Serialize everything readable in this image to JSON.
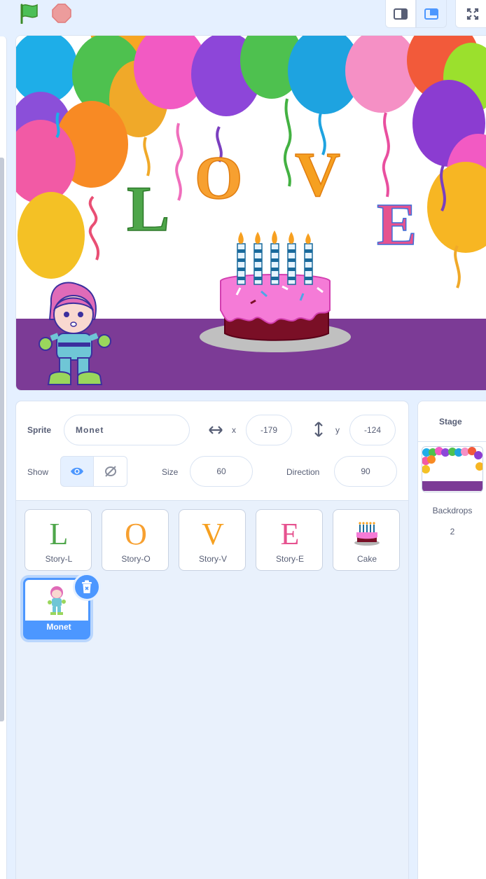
{
  "controls": {
    "green_flag_icon": "green-flag-icon",
    "stop_icon": "stop-sign-icon",
    "layout_modes": [
      "small-stage-icon",
      "normal-stage-icon",
      "fullscreen-icon"
    ]
  },
  "stage_art": {
    "letters": [
      "L",
      "O",
      "V",
      "E"
    ],
    "colors": {
      "ground": "#7c3b96",
      "accent": "#4c97ff"
    }
  },
  "sprite_info": {
    "sprite_label": "Sprite",
    "sprite_name": "Monet",
    "x_label": "x",
    "x_value": "-179",
    "y_label": "y",
    "y_value": "-124",
    "show_label": "Show",
    "size_label": "Size",
    "size_value": "60",
    "direction_label": "Direction",
    "direction_value": "90"
  },
  "sprites": [
    {
      "name": "Story-L",
      "glyph": "L"
    },
    {
      "name": "Story-O",
      "glyph": "O"
    },
    {
      "name": "Story-V",
      "glyph": "V"
    },
    {
      "name": "Story-E",
      "glyph": "E"
    },
    {
      "name": "Cake",
      "glyph": ""
    },
    {
      "name": "Monet",
      "glyph": "",
      "selected": true
    }
  ],
  "stage_panel": {
    "title": "Stage",
    "backdrops_label": "Backdrops",
    "backdrops_count": "2"
  }
}
